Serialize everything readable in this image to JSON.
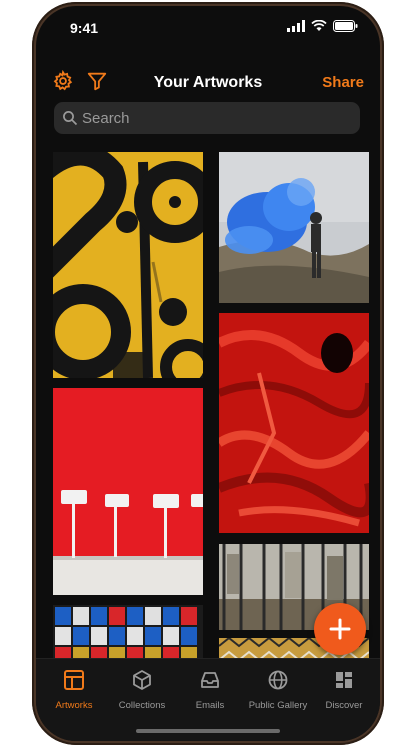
{
  "status_bar": {
    "time": "9:41"
  },
  "header": {
    "title": "Your Artworks",
    "share_label": "Share"
  },
  "search": {
    "placeholder": "Search"
  },
  "artworks": [
    {
      "name": "yellow-typography-artwork"
    },
    {
      "name": "blue-smoke-photo"
    },
    {
      "name": "red-wall-mops-photo"
    },
    {
      "name": "red-paint-texture-artwork"
    },
    {
      "name": "mirror-panels-photo"
    },
    {
      "name": "pattern-fabric-artwork"
    },
    {
      "name": "coca-cola-cans-photo"
    }
  ],
  "tab_bar": {
    "items": [
      {
        "label": "Artworks",
        "icon": "artworks-icon",
        "active": true
      },
      {
        "label": "Collections",
        "icon": "cube-icon",
        "active": false
      },
      {
        "label": "Emails",
        "icon": "inbox-icon",
        "active": false
      },
      {
        "label": "Public Gallery",
        "icon": "globe-icon",
        "active": false
      },
      {
        "label": "Discover",
        "icon": "grid-icon",
        "active": false
      }
    ]
  },
  "colors": {
    "accent": "#f07a1a",
    "fab": "#f05a1c",
    "background": "#0d0d0d"
  }
}
